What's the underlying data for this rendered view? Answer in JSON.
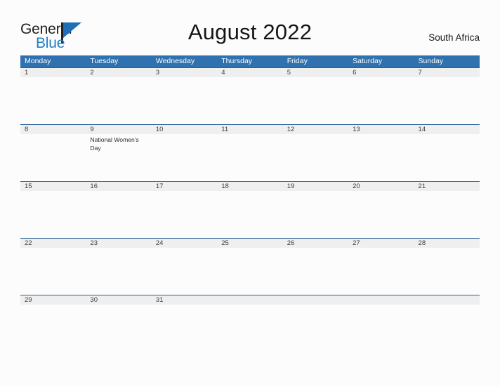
{
  "header": {
    "logo": {
      "text_primary": "General",
      "text_secondary": "Blue",
      "pole_icon": "flag-pole-icon",
      "flag_icon": "blue-triangle-flag-icon",
      "primary_color": "#231f20",
      "secondary_color": "#1f7fc4",
      "flag_color": "#1f6fb8"
    },
    "title": "August 2022",
    "country": "South Africa"
  },
  "calendar": {
    "header_background": "#3071b0",
    "header_text_color": "#ffffff",
    "daynum_background": "#efefef",
    "rule_color": "#2a6096",
    "weekdays": [
      "Monday",
      "Tuesday",
      "Wednesday",
      "Thursday",
      "Friday",
      "Saturday",
      "Sunday"
    ],
    "weeks": [
      {
        "days": [
          {
            "num": "1",
            "events": []
          },
          {
            "num": "2",
            "events": []
          },
          {
            "num": "3",
            "events": []
          },
          {
            "num": "4",
            "events": []
          },
          {
            "num": "5",
            "events": []
          },
          {
            "num": "6",
            "events": []
          },
          {
            "num": "7",
            "events": []
          }
        ]
      },
      {
        "days": [
          {
            "num": "8",
            "events": []
          },
          {
            "num": "9",
            "events": [
              "National Women's Day"
            ]
          },
          {
            "num": "10",
            "events": []
          },
          {
            "num": "11",
            "events": []
          },
          {
            "num": "12",
            "events": []
          },
          {
            "num": "13",
            "events": []
          },
          {
            "num": "14",
            "events": []
          }
        ]
      },
      {
        "days": [
          {
            "num": "15",
            "events": []
          },
          {
            "num": "16",
            "events": []
          },
          {
            "num": "17",
            "events": []
          },
          {
            "num": "18",
            "events": []
          },
          {
            "num": "19",
            "events": []
          },
          {
            "num": "20",
            "events": []
          },
          {
            "num": "21",
            "events": []
          }
        ]
      },
      {
        "days": [
          {
            "num": "22",
            "events": []
          },
          {
            "num": "23",
            "events": []
          },
          {
            "num": "24",
            "events": []
          },
          {
            "num": "25",
            "events": []
          },
          {
            "num": "26",
            "events": []
          },
          {
            "num": "27",
            "events": []
          },
          {
            "num": "28",
            "events": []
          }
        ]
      },
      {
        "days": [
          {
            "num": "29",
            "events": []
          },
          {
            "num": "30",
            "events": []
          },
          {
            "num": "31",
            "events": []
          },
          {
            "num": "",
            "events": []
          },
          {
            "num": "",
            "events": []
          },
          {
            "num": "",
            "events": []
          },
          {
            "num": "",
            "events": []
          }
        ]
      }
    ]
  }
}
